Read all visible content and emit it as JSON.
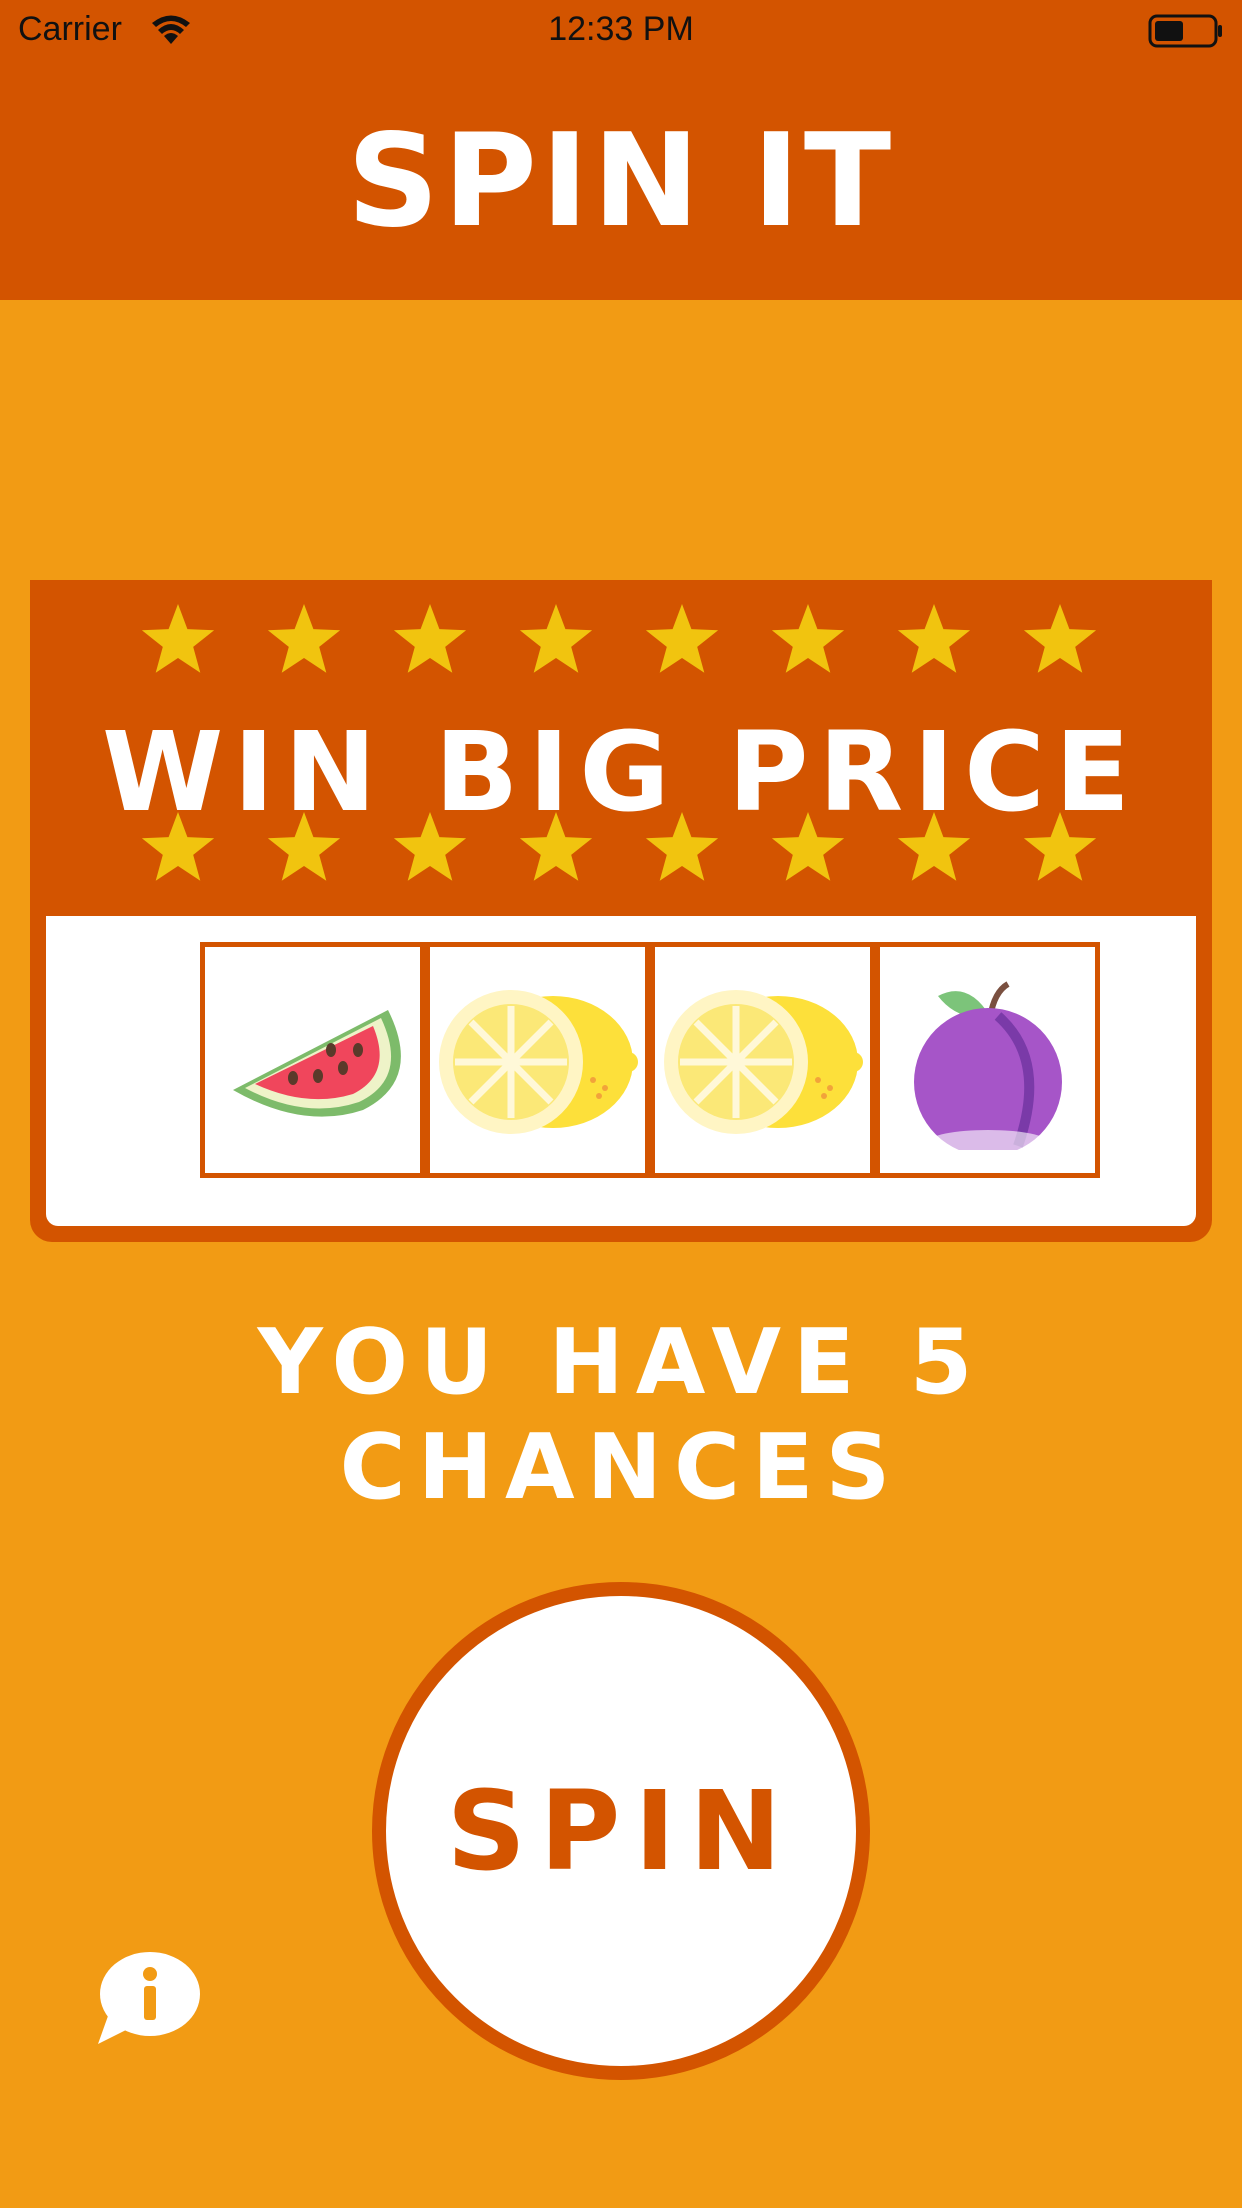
{
  "status_bar": {
    "carrier": "Carrier",
    "time": "12:33 PM",
    "battery_level": 0.5
  },
  "header": {
    "title": "SPIN IT"
  },
  "machine": {
    "title": "WIN BIG PRICE",
    "reels": [
      {
        "icon": "watermelon-icon"
      },
      {
        "icon": "lemon-icon"
      },
      {
        "icon": "lemon-icon"
      },
      {
        "icon": "plum-icon"
      }
    ]
  },
  "chances_text": "YOU HAVE 5 CHANCES",
  "spin_button": {
    "label": "SPIN"
  },
  "info_button": {
    "icon": "info-icon"
  },
  "colors": {
    "background": "#f29b14",
    "header": "#d35400",
    "star": "#f1c40f",
    "text": "#ffffff"
  }
}
